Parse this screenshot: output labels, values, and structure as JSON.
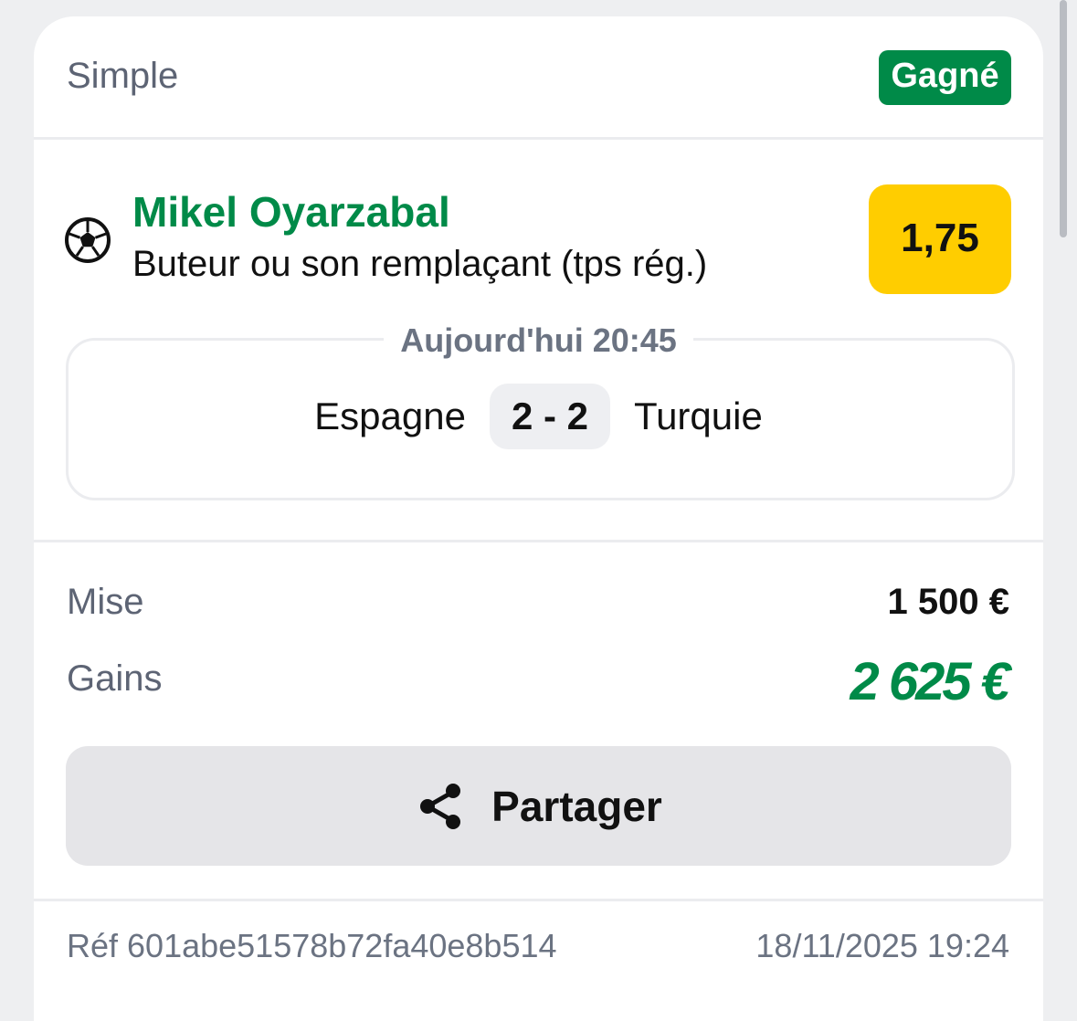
{
  "header": {
    "bet_type": "Simple",
    "status": "Gagné"
  },
  "selection": {
    "sport_icon": "soccer-ball-icon",
    "player": "Mikel Oyarzabal",
    "market": "Buteur ou son remplaçant (tps rég.)",
    "odds": "1,75"
  },
  "match": {
    "time": "Aujourd'hui 20:45",
    "home_team": "Espagne",
    "score": "2 - 2",
    "away_team": "Turquie"
  },
  "summary": {
    "stake_label": "Mise",
    "stake_value": "1 500 €",
    "winnings_label": "Gains",
    "winnings_value": "2 625 €"
  },
  "actions": {
    "share_icon": "share-icon",
    "share_label": "Partager"
  },
  "footer": {
    "reference": "Réf 601abe51578b72fa40e8b514",
    "date": "18/11/2025 19:24"
  },
  "colors": {
    "accent_green": "#008a48",
    "odds_yellow": "#ffcd00",
    "page_background": "#eeeff1"
  }
}
